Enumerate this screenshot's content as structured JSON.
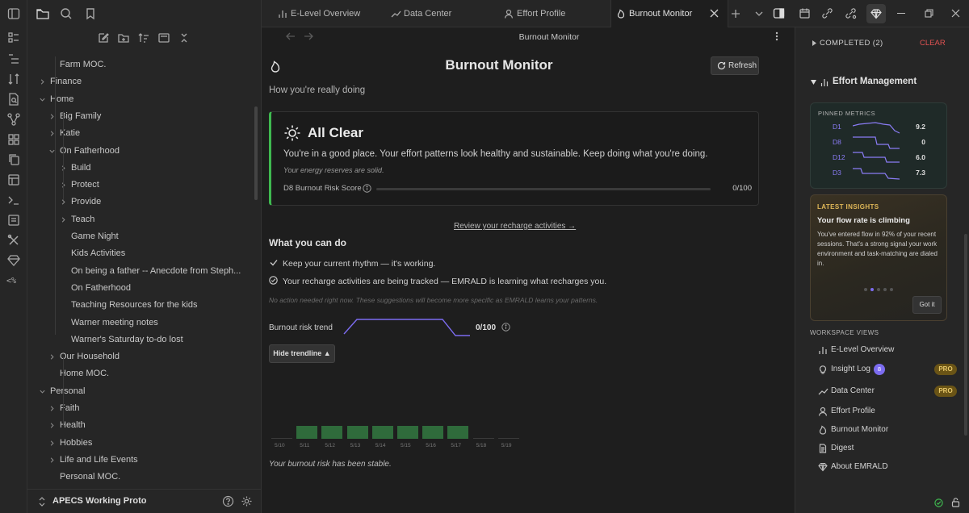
{
  "left_sidebar": {
    "tree": [
      {
        "label": "Farm MOC.",
        "depth": 2,
        "chevron": "none"
      },
      {
        "label": "Finance",
        "depth": 1,
        "chevron": "right"
      },
      {
        "label": "Home",
        "depth": 1,
        "chevron": "down"
      },
      {
        "label": "Big Family",
        "depth": 2,
        "chevron": "right"
      },
      {
        "label": "Katie",
        "depth": 2,
        "chevron": "right"
      },
      {
        "label": "On Fatherhood",
        "depth": 2,
        "chevron": "down"
      },
      {
        "label": "Build",
        "depth": 3,
        "chevron": "right"
      },
      {
        "label": "Protect",
        "depth": 3,
        "chevron": "right"
      },
      {
        "label": "Provide",
        "depth": 3,
        "chevron": "right"
      },
      {
        "label": "Teach",
        "depth": 3,
        "chevron": "right"
      },
      {
        "label": "Game Night",
        "depth": 3,
        "chevron": "none"
      },
      {
        "label": "Kids Activities",
        "depth": 3,
        "chevron": "none"
      },
      {
        "label": "On being a father -- Anecdote from Steph...",
        "depth": 3,
        "chevron": "none"
      },
      {
        "label": "On Fatherhood",
        "depth": 3,
        "chevron": "none"
      },
      {
        "label": "Teaching Resources for the kids",
        "depth": 3,
        "chevron": "none"
      },
      {
        "label": "Warner meeting notes",
        "depth": 3,
        "chevron": "none"
      },
      {
        "label": "Warner's Saturday to-do lost",
        "depth": 3,
        "chevron": "none"
      },
      {
        "label": "Our Household",
        "depth": 2,
        "chevron": "right"
      },
      {
        "label": "Home MOC.",
        "depth": 2,
        "chevron": "none"
      },
      {
        "label": "Personal",
        "depth": 1,
        "chevron": "down"
      },
      {
        "label": "Faith",
        "depth": 2,
        "chevron": "right"
      },
      {
        "label": "Health",
        "depth": 2,
        "chevron": "right"
      },
      {
        "label": "Hobbies",
        "depth": 2,
        "chevron": "right"
      },
      {
        "label": "Life and Life Events",
        "depth": 2,
        "chevron": "right"
      },
      {
        "label": "Personal MOC.",
        "depth": 2,
        "chevron": "none"
      }
    ],
    "vault_name": "APECS Working Proto"
  },
  "tabs": [
    {
      "label": "E-Level Overview",
      "icon": "bar-chart-icon"
    },
    {
      "label": "Data Center",
      "icon": "trend-icon"
    },
    {
      "label": "Effort Profile",
      "icon": "user-icon"
    },
    {
      "label": "Burnout Monitor",
      "icon": "flame-icon",
      "active": true
    }
  ],
  "main": {
    "header_title": "Burnout Monitor",
    "title": "Burnout Monitor",
    "refresh_label": "Refresh",
    "subtitle": "How you're really doing",
    "status": {
      "title": "All Clear",
      "message": "You're in a good place. Your effort patterns look healthy and sustainable. Keep doing what you're doing.",
      "note": "Your energy reserves are solid.",
      "score_label": "D8 Burnout Risk Score",
      "score_value": "0/100",
      "score_fraction": 0,
      "accent": "#3fb950"
    },
    "review_link": "Review your recharge activities →",
    "actions_heading": "What you can do",
    "actions": [
      "Keep your current rhythm — it's working.",
      "Your recharge activities are being tracked — EMRALD is learning what recharges you."
    ],
    "footnote": "No action needed right now. These suggestions will become more specific as EMRALD learns your patterns.",
    "trend_label": "Burnout risk trend",
    "trend_value": "0/100",
    "hide_trend_label": "Hide trendline ▲",
    "stable_note": "Your burnout risk has been stable."
  },
  "chart_data": {
    "type": "bar",
    "categories": [
      "5/10",
      "5/11",
      "5/12",
      "5/13",
      "5/14",
      "5/15",
      "5/16",
      "5/17",
      "5/18",
      "5/19"
    ],
    "has_data": [
      false,
      true,
      true,
      true,
      true,
      true,
      true,
      true,
      false,
      false
    ]
  },
  "right_sidebar": {
    "completed_label": "COMPLETED (2)",
    "clear_label": "CLEAR",
    "section_title": "Effort Management",
    "pinned_heading": "PINNED METRICS",
    "pinned_metrics": [
      {
        "name": "D1",
        "value": "9.2"
      },
      {
        "name": "D8",
        "value": "0"
      },
      {
        "name": "D12",
        "value": "6.0"
      },
      {
        "name": "D3",
        "value": "7.3"
      }
    ],
    "insights_heading": "LATEST INSIGHTS",
    "insight_title": "Your flow rate is climbing",
    "insight_text": "You've entered flow in 92% of your recent sessions. That's a strong signal your work environment and task-matching are dialed in.",
    "got_it_label": "Got it",
    "workspace_heading": "WORKSPACE VIEWS",
    "views": [
      {
        "label": "E-Level Overview",
        "icon": "bar-chart-icon"
      },
      {
        "label": "Insight Log",
        "icon": "bulb-icon",
        "badge": "8",
        "pro": "PRO"
      },
      {
        "label": "Data Center",
        "icon": "trend-icon",
        "pro": "PRO"
      },
      {
        "label": "Effort Profile",
        "icon": "user-icon"
      },
      {
        "label": "Burnout Monitor",
        "icon": "flame-icon"
      },
      {
        "label": "Digest",
        "icon": "document-icon"
      },
      {
        "label": "About EMRALD",
        "icon": "gem-icon"
      }
    ]
  },
  "colors": {
    "accent_green": "#3fb950",
    "accent_purple": "#7c6cf0",
    "pro_gold": "#e7c86a",
    "clear_red": "#e05252"
  }
}
